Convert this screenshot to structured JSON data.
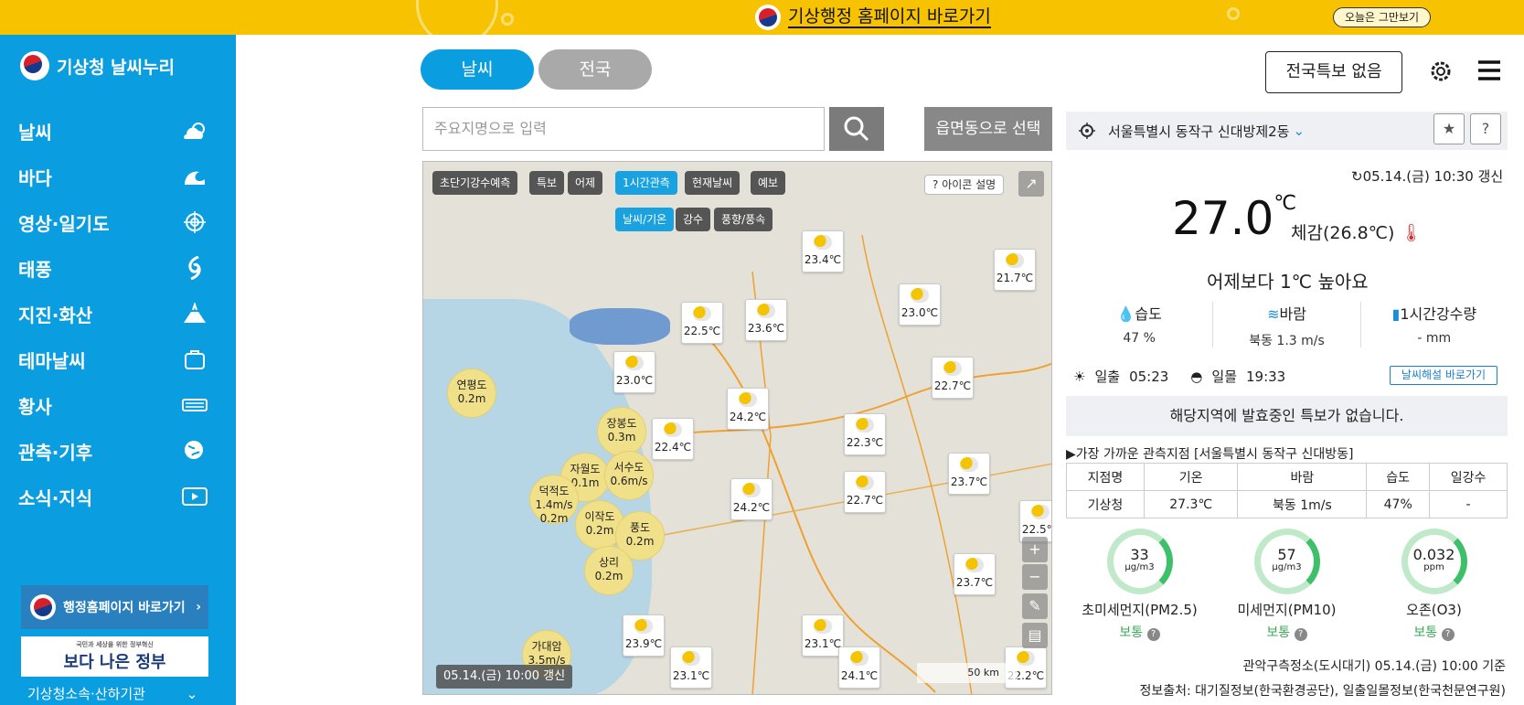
{
  "topbar": {
    "link_text": "기상행정 홈페이지 바로가기",
    "close_label": "오늘은 그만보기"
  },
  "sidebar": {
    "brand": "기상청 날씨누리",
    "items": [
      {
        "label": "날씨",
        "icon": "sun-cloud-icon"
      },
      {
        "label": "바다",
        "icon": "wave-icon"
      },
      {
        "label": "영상·일기도",
        "icon": "target-icon"
      },
      {
        "label": "태풍",
        "icon": "typhoon-icon"
      },
      {
        "label": "지진·화산",
        "icon": "volcano-icon"
      },
      {
        "label": "테마날씨",
        "icon": "bag-icon"
      },
      {
        "label": "황사",
        "icon": "dust-icon"
      },
      {
        "label": "관측·기후",
        "icon": "globe-icon"
      },
      {
        "label": "소식·지식",
        "icon": "video-icon"
      }
    ],
    "admin_button": "행정홈페이지 바로가기",
    "gov_banner": "보다 나은 정부",
    "gov_banner_small": "국민과 세상을 위한 정부혁신",
    "footer": "기상청소속·산하기관"
  },
  "tabs": {
    "weather": "날씨",
    "national": "전국"
  },
  "search": {
    "placeholder": "주요지명으로 입력",
    "select_label": "읍면동으로 선택"
  },
  "map": {
    "tabs": [
      "초단기강수예측",
      "특보",
      "어제",
      "1시간관측",
      "현재날씨",
      "예보"
    ],
    "subtabs": [
      "날씨/기온",
      "강수",
      "풍향/풍속"
    ],
    "icon_help": "아이콘 설명",
    "update": "05.14.(금) 10:00 갱신",
    "stations": [
      {
        "temp": "23.4℃"
      },
      {
        "temp": "21.7℃"
      },
      {
        "temp": "23.0℃"
      },
      {
        "temp": "22.5℃"
      },
      {
        "temp": "23.6℃"
      },
      {
        "temp": "23.0℃"
      },
      {
        "temp": "22.7℃"
      },
      {
        "temp": "24.2℃"
      },
      {
        "temp": "22.4℃"
      },
      {
        "temp": "22.3℃"
      },
      {
        "temp": "23.7℃"
      },
      {
        "temp": "24.2℃"
      },
      {
        "temp": "22.7℃"
      },
      {
        "temp": "22.5℃"
      },
      {
        "temp": "23.7℃"
      },
      {
        "temp": "23.9℃"
      },
      {
        "temp": "23.1℃"
      },
      {
        "temp": "23.1℃"
      },
      {
        "temp": "24.1℃"
      },
      {
        "temp": "22.2℃"
      }
    ],
    "buoys": [
      {
        "name": "연평도",
        "val": "0.2m"
      },
      {
        "name": "장봉도",
        "val": "0.3m"
      },
      {
        "name": "자월도",
        "val": "0.1m"
      },
      {
        "name": "서수도",
        "val": "0.6m/s"
      },
      {
        "name": "덕적도",
        "val": "1.4m/s 0.2m"
      },
      {
        "name": "이작도",
        "val": "0.2m"
      },
      {
        "name": "풍도",
        "val": "0.2m"
      },
      {
        "name": "상리",
        "val": "0.2m"
      },
      {
        "name": "가대암",
        "val": "3.5m/s"
      }
    ],
    "scale": "50 km"
  },
  "header": {
    "warning": "전국특보 없음"
  },
  "location": {
    "name": "서울특별시 동작구 신대방제2동"
  },
  "current": {
    "updated": "05.14.(금) 10:30 갱신",
    "temp": "27.0",
    "unit": "℃",
    "feels": "체감(26.8℃)",
    "compare": "어제보다 1℃ 높아요",
    "humidity_label": "습도",
    "humidity": "47 %",
    "wind_label": "바람",
    "wind": "북동 1.3 m/s",
    "rain_label": "1시간강수량",
    "rain": "- mm",
    "sunrise_label": "일출",
    "sunrise": "05:23",
    "sunset_label": "일몰",
    "sunset": "19:33",
    "explain_btn": "날씨해설 바로가기",
    "no_warning": "해당지역에 발효중인 특보가 없습니다."
  },
  "obs": {
    "title": "▶가장 가까운 관측지점 [서울특별시 동작구 신대방동]",
    "headers": [
      "지점명",
      "기온",
      "바람",
      "습도",
      "일강수"
    ],
    "row": [
      "기상청",
      "27.3℃",
      "북동 1m/s",
      "47%",
      "-"
    ]
  },
  "air": [
    {
      "value": "33",
      "unit": "μg/m3",
      "name": "초미세먼지(PM2.5)",
      "status": "보통"
    },
    {
      "value": "57",
      "unit": "μg/m3",
      "name": "미세먼지(PM10)",
      "status": "보통"
    },
    {
      "value": "0.032",
      "unit": "ppm",
      "name": "오존(O3)",
      "status": "보통"
    }
  ],
  "source": {
    "line1": "관악구측정소(도시대기) 05.14.(금) 10:00 기준",
    "line2": "정보출처: 대기질정보(한국환경공단), 일출일몰정보(한국천문연구원)"
  }
}
